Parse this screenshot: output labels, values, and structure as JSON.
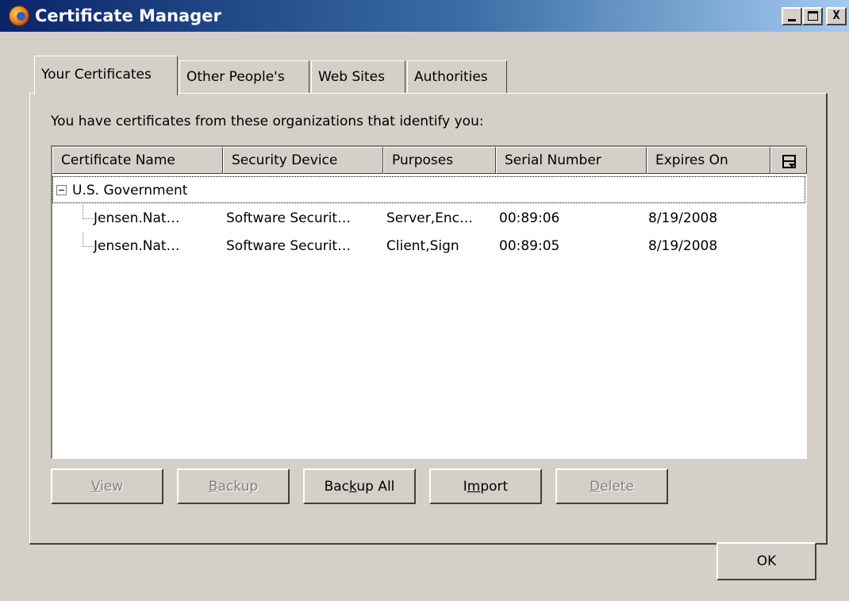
{
  "window": {
    "title": "Certificate Manager",
    "minimize": "_",
    "maximize": "",
    "close": "X"
  },
  "tabs": [
    {
      "label": "Your Certificates",
      "selected": true
    },
    {
      "label": "Other People's",
      "selected": false
    },
    {
      "label": "Web Sites",
      "selected": false
    },
    {
      "label": "Authorities",
      "selected": false
    }
  ],
  "panel": {
    "description": "You have certificates from these organizations that identify you:"
  },
  "tree": {
    "columns": [
      "Certificate Name",
      "Security Device",
      "Purposes",
      "Serial Number",
      "Expires On"
    ],
    "group": {
      "name": "U.S. Government",
      "expanded": true
    },
    "rows": [
      {
        "name": "Jensen.Nat…",
        "device": "Software Securit…",
        "purposes": "Server,Enc…",
        "serial": "00:89:06",
        "expires": "8/19/2008"
      },
      {
        "name": "Jensen.Nat…",
        "device": "Software Securit…",
        "purposes": "Client,Sign",
        "serial": "00:89:05",
        "expires": "8/19/2008"
      }
    ],
    "column_picker_icon": "column-picker-icon"
  },
  "buttons": {
    "view": {
      "pre": "",
      "key": "V",
      "post": "iew",
      "enabled": false
    },
    "backup": {
      "pre": "",
      "key": "B",
      "post": "ackup",
      "enabled": false
    },
    "backup_all": {
      "pre": "Bac",
      "key": "k",
      "post": "up All",
      "enabled": true
    },
    "import": {
      "pre": "I",
      "key": "m",
      "post": "port",
      "enabled": true
    },
    "delete": {
      "pre": "",
      "key": "D",
      "post": "elete",
      "enabled": false
    },
    "ok": "OK"
  }
}
